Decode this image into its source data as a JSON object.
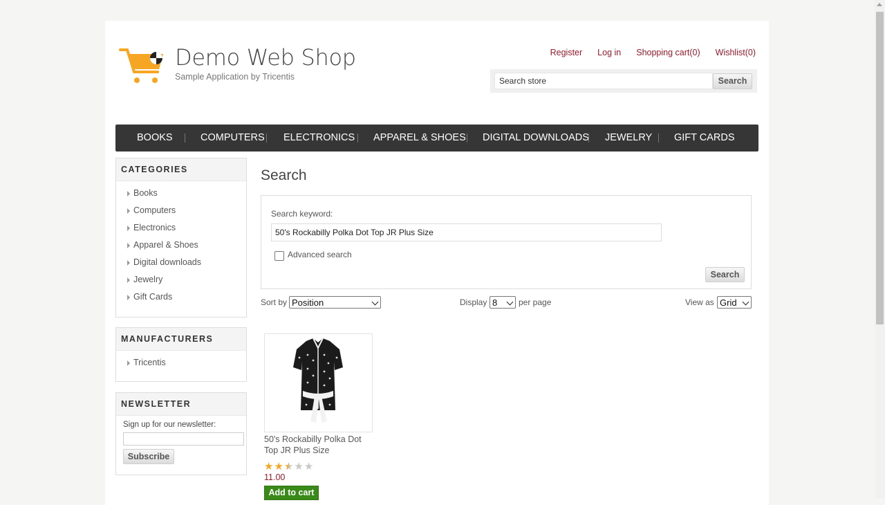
{
  "header": {
    "title": "Demo Web Shop",
    "subtitle": "Sample Application by Tricentis",
    "links": [
      "Register",
      "Log in",
      "Shopping cart(0)",
      "Wishlist(0)"
    ],
    "search_placeholder": "Search store",
    "search_button": "Search"
  },
  "nav": [
    "BOOKS",
    "COMPUTERS",
    "ELECTRONICS",
    "APPAREL & SHOES",
    "DIGITAL DOWNLOADS",
    "JEWELRY",
    "GIFT CARDS"
  ],
  "sidebar": {
    "categories_title": "CATEGORIES",
    "categories": [
      "Books",
      "Computers",
      "Electronics",
      "Apparel & Shoes",
      "Digital downloads",
      "Jewelry",
      "Gift Cards"
    ],
    "manufacturers_title": "MANUFACTURERS",
    "manufacturers": [
      "Tricentis"
    ],
    "newsletter_title": "NEWSLETTER",
    "newsletter_label": "Sign up for our newsletter:",
    "subscribe_button": "Subscribe"
  },
  "main": {
    "title": "Search",
    "keyword_label": "Search keyword:",
    "keyword_value": "50's Rockabilly Polka Dot Top JR Plus Size",
    "advanced_label": "Advanced search",
    "search_button": "Search",
    "sort_label": "Sort by",
    "sort_value": "Position",
    "display_label": "Display",
    "display_value": "8",
    "per_page_label": "per page",
    "view_label": "View as",
    "view_value": "Grid"
  },
  "product": {
    "name": "50's Rockabilly Polka Dot Top JR Plus Size",
    "rating": 2.5,
    "rating_max": 5,
    "price": "11.00",
    "add_to_cart": "Add to cart"
  },
  "colors": {
    "link": "#9b1a2a",
    "nav_bg": "#363636",
    "cart_green": "#3a8a1a",
    "star": "#f5a623",
    "logo_orange": "#f6a623"
  }
}
